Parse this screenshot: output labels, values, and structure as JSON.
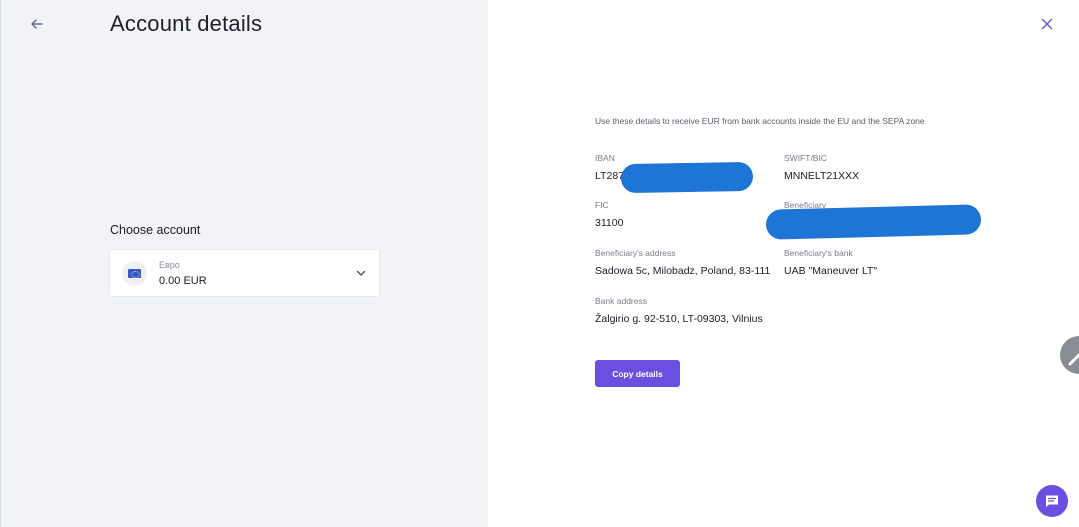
{
  "header": {
    "title": "Account details"
  },
  "sidebar": {
    "choose_label": "Choose account",
    "account": {
      "name": "Евро",
      "balance": "0.00 EUR",
      "flag_icon": "eu-flag-icon"
    }
  },
  "details": {
    "intro": "Use these details to receive EUR from bank accounts inside the EU and the SEPA zone",
    "iban": {
      "label": "IBAN",
      "value": "LT287"
    },
    "swift": {
      "label": "SWIFT/BIC",
      "value": "MNNELT21XXX"
    },
    "fic": {
      "label": "FIC",
      "value": "31100"
    },
    "beneficiary": {
      "label": "Beneficiary",
      "value": ""
    },
    "beneficiary_address": {
      "label": "Beneficiary's address",
      "value": "Sadowa 5c, Milobadz, Poland, 83-111"
    },
    "beneficiary_bank": {
      "label": "Beneficiary's bank",
      "value": "UAB \"Maneuver LT\""
    },
    "bank_address": {
      "label": "Bank address",
      "value": "Žalgirio g. 92-510, LT-09303, Vilnius"
    },
    "copy_button": "Copy details"
  },
  "colors": {
    "accent": "#6b4fe0",
    "left_bg": "#f2f3f7",
    "redaction": "#1f75d6"
  }
}
